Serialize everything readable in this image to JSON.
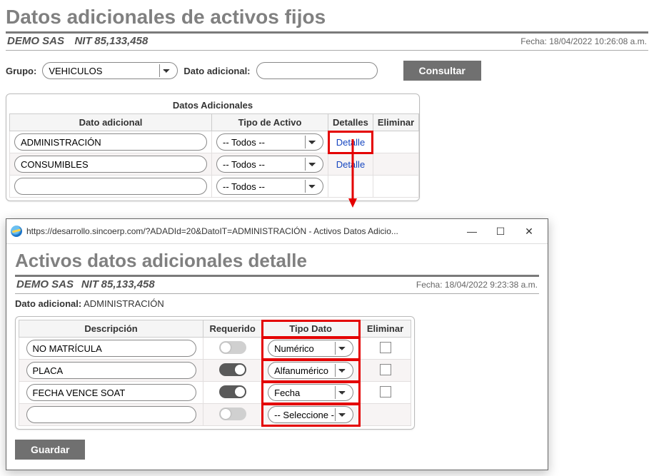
{
  "header": {
    "title": "Datos adicionales de activos fijos",
    "company": "DEMO SAS",
    "nit_label": "NIT",
    "nit": "85,133,458",
    "timestamp_label": "Fecha:",
    "timestamp": "18/04/2022 10:26:08 a.m."
  },
  "filters": {
    "grupo_label": "Grupo:",
    "grupo_value": "VEHICULOS",
    "dato_label": "Dato adicional:",
    "dato_value": "",
    "consultar": "Consultar"
  },
  "table": {
    "title": "Datos Adicionales",
    "cols": {
      "dato": "Dato adicional",
      "tipo": "Tipo de Activo",
      "detalles": "Detalles",
      "eliminar": "Eliminar"
    },
    "tipo_placeholder": "-- Todos --",
    "detalle_link": "Detalle",
    "rows": [
      {
        "dato": "ADMINISTRACIÓN",
        "tipo": "-- Todos --",
        "has_detail": true
      },
      {
        "dato": "CONSUMIBLES",
        "tipo": "-- Todos --",
        "has_detail": true
      },
      {
        "dato": "",
        "tipo": "-- Todos --",
        "has_detail": false
      }
    ]
  },
  "popup": {
    "url": "https://desarrollo.sincoerp.com/?ADADId=20&DatoIT=ADMINISTRACIÓN - Activos Datos Adicio...",
    "title": "Activos datos adicionales detalle",
    "company": "DEMO SAS",
    "nit_label": "NIT",
    "nit": "85,133,458",
    "timestamp_label": "Fecha:",
    "timestamp": "18/04/2022 9:23:38 a.m.",
    "dato_label": "Dato adicional:",
    "dato_value": "ADMINISTRACIÓN",
    "cols": {
      "desc": "Descripción",
      "req": "Requerido",
      "tipo": "Tipo Dato",
      "elim": "Eliminar"
    },
    "tipo_placeholder": "-- Seleccione --",
    "rows": [
      {
        "desc": "NO MATRÍCULA",
        "req": false,
        "tipo": "Numérico"
      },
      {
        "desc": "PLACA",
        "req": true,
        "tipo": "Alfanumérico"
      },
      {
        "desc": "FECHA VENCE SOAT",
        "req": true,
        "tipo": "Fecha"
      },
      {
        "desc": "",
        "req": false,
        "tipo": "-- Seleccione --"
      }
    ],
    "guardar": "Guardar"
  }
}
